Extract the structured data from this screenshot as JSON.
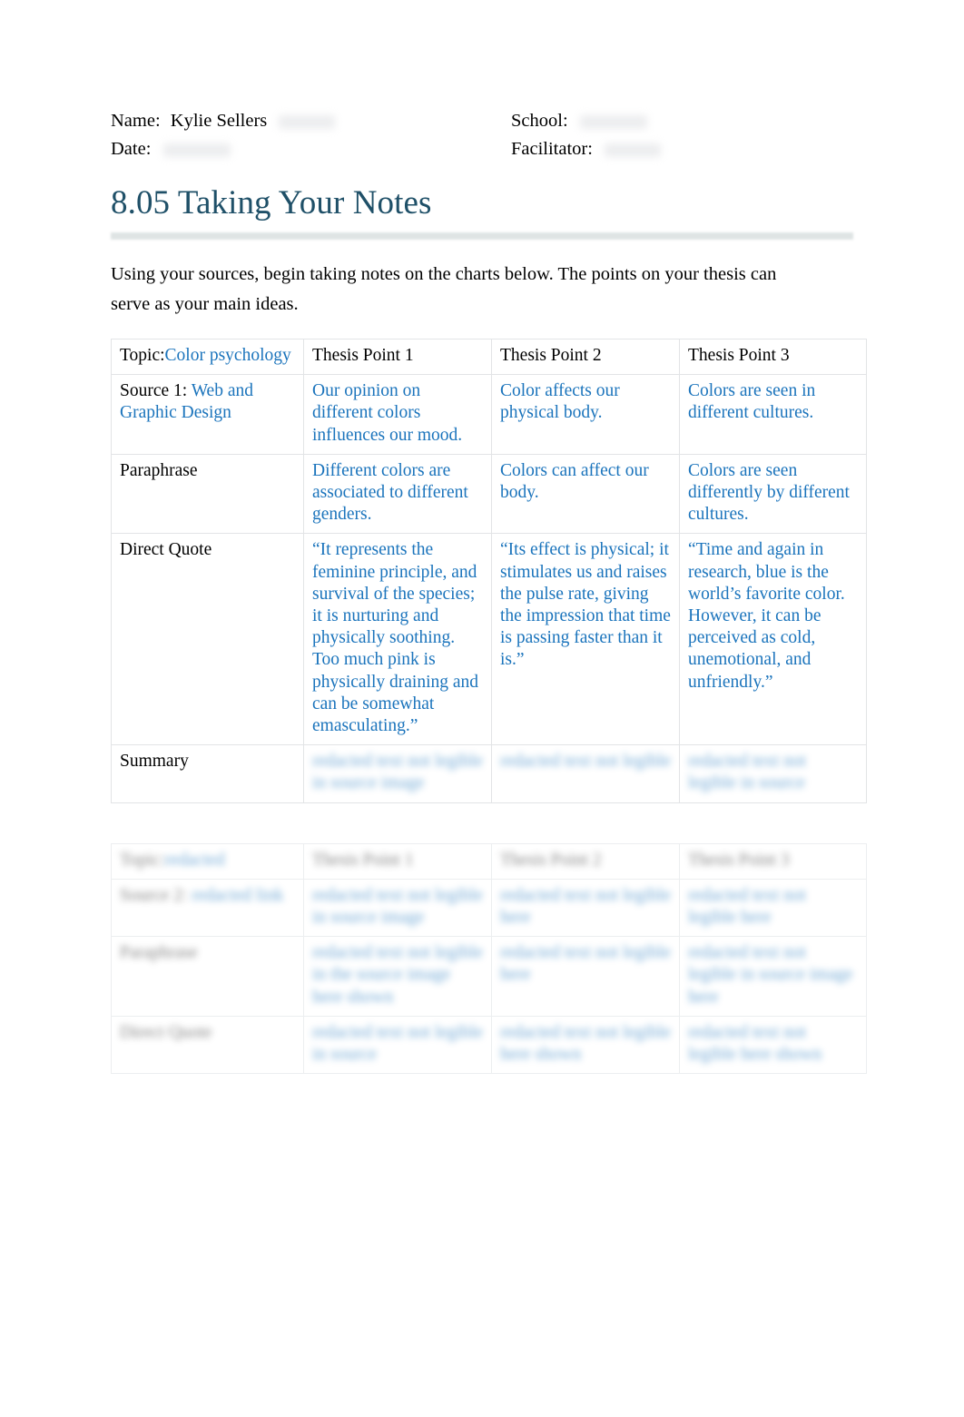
{
  "header": {
    "name_label": "Name:",
    "name_value": "Kylie Sellers",
    "date_label": "Date:",
    "date_value": "",
    "school_label": "School:",
    "school_value": "",
    "facilitator_label": "Facilitator:",
    "facilitator_value": ""
  },
  "title": "8.05 Taking Your Notes",
  "intro": "Using your sources, begin taking notes on the charts below. The points on your thesis can serve as your main ideas.",
  "colors": {
    "title": "#1F5068",
    "body_blue": "#1B74BC",
    "rule": "#dfe4e4",
    "table_border": "#e2e4e6"
  },
  "table1": {
    "headers": {
      "topic_label": "Topic:",
      "topic_value": "Color psychology",
      "point1": "Thesis Point 1",
      "point2": "Thesis Point 2",
      "point3": "Thesis Point 3"
    },
    "rows": [
      {
        "label_prefix": "Source 1: ",
        "label_value": "Web and Graphic Design",
        "label_is_link": true,
        "c1": "Our opinion on different colors influences our mood.",
        "c2": "Color affects our physical body.",
        "c3": "Colors are seen in different cultures."
      },
      {
        "label_prefix": "Paraphrase",
        "label_value": "",
        "label_is_link": false,
        "c1": "Different colors are associated to different genders.",
        "c2": "Colors can affect our body.",
        "c3": "Colors are seen differently by different cultures."
      },
      {
        "label_prefix": "Direct Quote",
        "label_value": "",
        "label_is_link": false,
        "c1": "“It represents the feminine principle, and survival of the species; it is nurturing and physically soothing. Too much pink is physically draining and can be somewhat emasculating.”",
        "c2": "“Its effect is physical; it stimulates us and raises the pulse rate, giving the impression that time is passing faster than it is.”",
        "c3": "“Time and again in research, blue is the world’s favorite color. However, it can be perceived as cold, unemotional, and unfriendly.”"
      },
      {
        "label_prefix": "Summary",
        "label_value": "",
        "label_is_link": false,
        "c1": "redacted text not legible in source image",
        "c2": "redacted text not legible",
        "c3": "redacted text not legible in source",
        "blurred": true
      }
    ]
  },
  "table2": {
    "blurred": true,
    "headers": {
      "topic_label": "Topic:",
      "topic_value": "redacted",
      "point1": "Thesis Point 1",
      "point2": "Thesis Point 2",
      "point3": "Thesis Point 3"
    },
    "rows": [
      {
        "label_prefix": "Source 2:",
        "label_value": "redacted link",
        "c1": "redacted text not legible in source image",
        "c2": "redacted text not legible here",
        "c3": "redacted text not legible here"
      },
      {
        "label_prefix": "Paraphrase",
        "label_value": "",
        "c1": "redacted text not legible in the source image here shown",
        "c2": "redacted text not legible here",
        "c3": "redacted text not legible in source image here"
      },
      {
        "label_prefix": "Direct Quote",
        "label_value": "",
        "c1": "redacted text not legible in source",
        "c2": "redacted text not legible here shown",
        "c3": "redacted text not legible here shown"
      }
    ]
  }
}
